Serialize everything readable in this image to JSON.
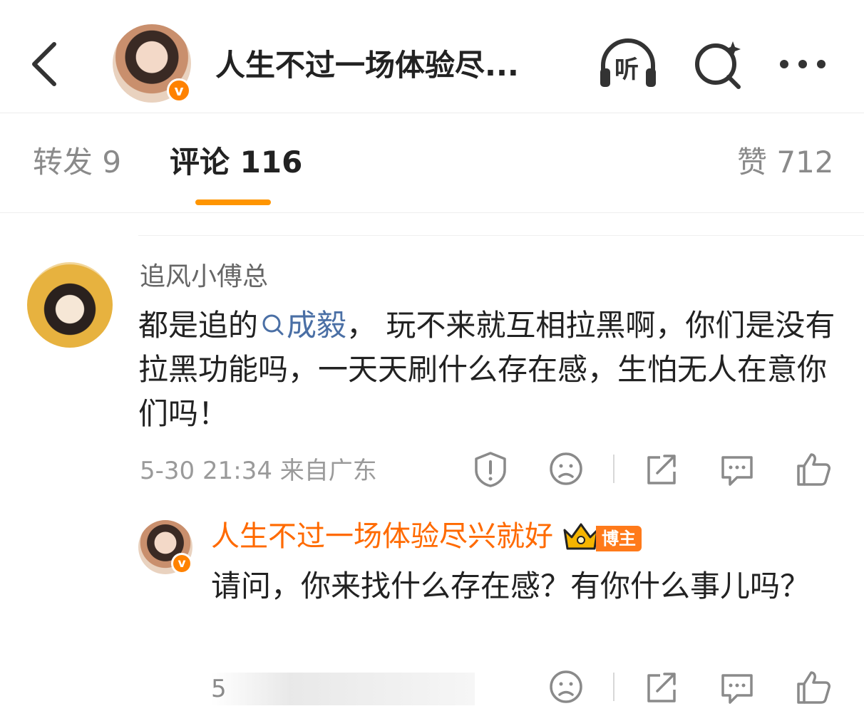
{
  "header": {
    "title": "人生不过一场体验尽...",
    "listen_label": "听",
    "verified_badge": "v"
  },
  "tabs": {
    "repost": "转发 9",
    "comment": "评论 116",
    "like": "赞 712"
  },
  "comment": {
    "username": "追风小傅总",
    "text_before": "都是追的",
    "topic": "成毅",
    "text_after": "，  玩不来就互相拉黑啊，你们是没有拉黑功能吗，一天天刷什么存在感，生怕无人在意你们吗！",
    "meta": "5-30 21:34  来自广东"
  },
  "reply": {
    "username": "人生不过一场体验尽兴就好",
    "owner_badge": "博主",
    "text": "请问，你来找什么存在感？有你什么事儿吗？",
    "meta_partial": "5"
  },
  "colors": {
    "accent_orange": "#ff9500",
    "verified_orange": "#ff8200",
    "link_blue": "#4a6fa5",
    "reply_user_orange": "#ff6a00"
  }
}
